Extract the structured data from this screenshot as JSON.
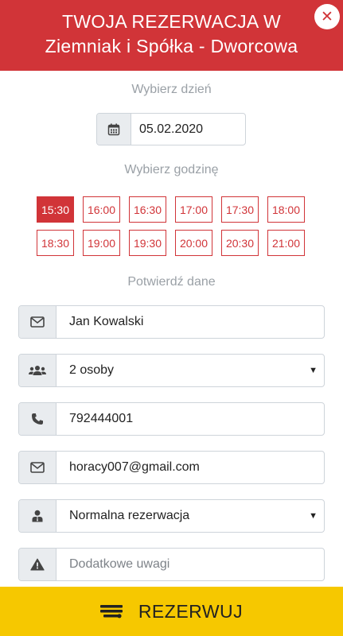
{
  "header": {
    "title_line1": "TWOJA REZERWACJA W",
    "title_line2": "Ziemniak i Spółka - Dworcowa",
    "close_symbol": "✕"
  },
  "date_section": {
    "label": "Wybierz dzień",
    "value": "05.02.2020"
  },
  "time_section": {
    "label": "Wybierz godzinę",
    "slots": [
      "15:30",
      "16:00",
      "16:30",
      "17:00",
      "17:30",
      "18:00",
      "18:30",
      "19:00",
      "19:30",
      "20:00",
      "20:30",
      "21:00"
    ],
    "selected": "15:30"
  },
  "confirm_section": {
    "label": "Potwierdź dane",
    "name": "Jan Kowalski",
    "guests": "2 osoby",
    "phone": "792444001",
    "email": "horacy007@gmail.com",
    "reservation_type": "Normalna rezerwacja",
    "notes_placeholder": "Dodatkowe uwagi"
  },
  "reserve_button": {
    "label": "REZERWUJ"
  },
  "colors": {
    "brand_red": "#d13438",
    "button_yellow": "#f6c800"
  },
  "icons": {
    "close": "close-icon",
    "calendar": "calendar-icon",
    "name": "envelope-icon",
    "guests": "users-icon",
    "phone": "phone-icon",
    "email": "envelope-icon",
    "type": "user-icon",
    "notes": "warning-icon",
    "reserve": "cutlery-icon"
  }
}
